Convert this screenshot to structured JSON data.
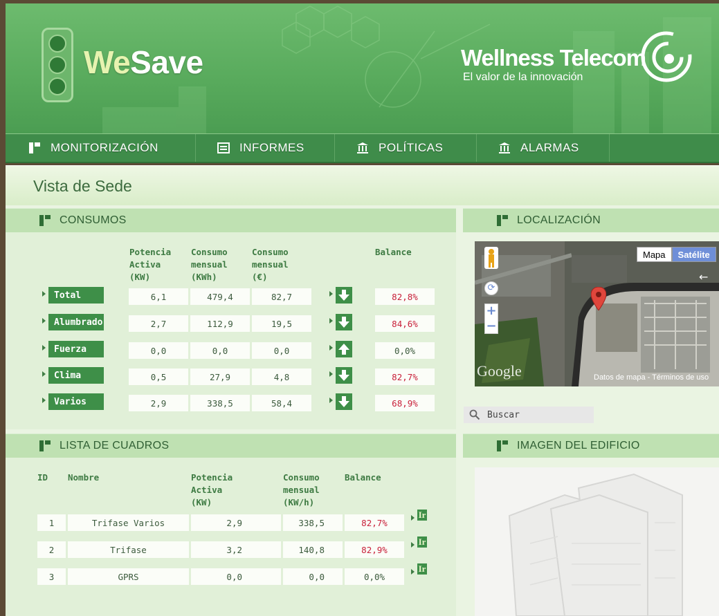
{
  "header": {
    "app_name_we": "We",
    "app_name_save": "Save",
    "company_name": "Wellness Telecom",
    "company_tagline": "El valor de la innovación"
  },
  "nav": {
    "items": [
      {
        "label": "MONITORIZACIÓN",
        "icon": "grid-icon"
      },
      {
        "label": "INFORMES",
        "icon": "report-icon"
      },
      {
        "label": "POLÍTICAS",
        "icon": "building-columns-icon"
      },
      {
        "label": "ALARMAS",
        "icon": "building-columns-icon"
      }
    ]
  },
  "page": {
    "title": "Vista de Sede"
  },
  "consumos": {
    "title": "CONSUMOS",
    "headers": [
      "Potencia\nActiva\n(KW)",
      "Consumo\nmensual\n(KWh)",
      "Consumo\nmensual\n(€)",
      "Balance"
    ],
    "rows": [
      {
        "label": "Total",
        "potencia": "6,1",
        "kwh": "479,4",
        "eur": "82,7",
        "trend": "down",
        "balance": "82,8%",
        "balance_red": true
      },
      {
        "label": "Alumbrado",
        "potencia": "2,7",
        "kwh": "112,9",
        "eur": "19,5",
        "trend": "down",
        "balance": "84,6%",
        "balance_red": true
      },
      {
        "label": "Fuerza",
        "potencia": "0,0",
        "kwh": "0,0",
        "eur": "0,0",
        "trend": "up",
        "balance": "0,0%",
        "balance_red": false
      },
      {
        "label": "Clima",
        "potencia": "0,5",
        "kwh": "27,9",
        "eur": "4,8",
        "trend": "down",
        "balance": "82,7%",
        "balance_red": true
      },
      {
        "label": "Varios",
        "potencia": "2,9",
        "kwh": "338,5",
        "eur": "58,4",
        "trend": "down",
        "balance": "68,9%",
        "balance_red": true
      }
    ]
  },
  "cuadros": {
    "title": "LISTA DE CUADROS",
    "headers": [
      "ID",
      "Nombre",
      "Potencia\nActiva\n(KW)",
      "Consumo\nmensual\n(KW/h)",
      "Balance"
    ],
    "rows": [
      {
        "id": "1",
        "name": "Trifase Varios",
        "potencia": "2,9",
        "consumo": "338,5",
        "balance": "82,7%",
        "balance_red": true,
        "action": "Ir"
      },
      {
        "id": "2",
        "name": "Trifase",
        "potencia": "3,2",
        "consumo": "140,8",
        "balance": "82,9%",
        "balance_red": true,
        "action": "Ir"
      },
      {
        "id": "3",
        "name": "GPRS",
        "potencia": "0,0",
        "consumo": "0,0",
        "balance": "0,0%",
        "balance_red": false,
        "action": "Ir"
      }
    ]
  },
  "localizacion": {
    "title": "LOCALIZACIÓN",
    "map_type_map": "Mapa",
    "map_type_sat": "Satélite",
    "map_logo": "Google",
    "map_terms": "Datos de mapa - Términos de uso",
    "zoom_in": "+",
    "zoom_out": "−"
  },
  "search": {
    "label": "Buscar"
  },
  "imagen": {
    "title": "IMAGEN DEL EDIFICIO"
  },
  "colors": {
    "nav_bg": "#3f8c4a",
    "accent_green": "#3e8f48",
    "balance_red": "#c8203a",
    "panel_head": "#bfe1b2"
  }
}
